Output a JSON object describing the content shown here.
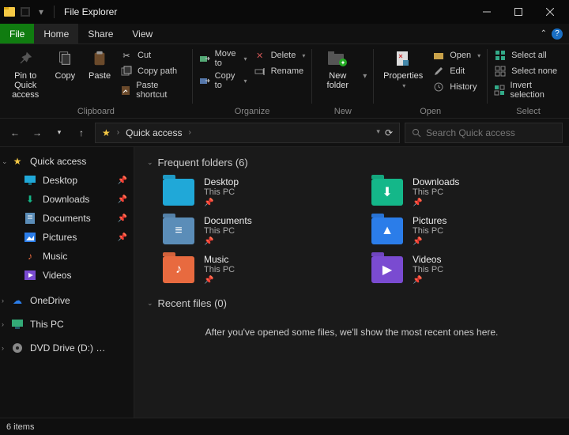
{
  "window": {
    "title": "File Explorer"
  },
  "tabs": {
    "file": "File",
    "home": "Home",
    "share": "Share",
    "view": "View"
  },
  "ribbon": {
    "clipboard": {
      "label": "Clipboard",
      "pin": "Pin to Quick access",
      "copy": "Copy",
      "paste": "Paste",
      "cut": "Cut",
      "copy_path": "Copy path",
      "paste_shortcut": "Paste shortcut"
    },
    "organize": {
      "label": "Organize",
      "move_to": "Move to",
      "copy_to": "Copy to",
      "delete": "Delete",
      "rename": "Rename"
    },
    "new": {
      "label": "New",
      "new_folder": "New folder"
    },
    "open": {
      "label": "Open",
      "properties": "Properties",
      "open": "Open",
      "edit": "Edit",
      "history": "History"
    },
    "select": {
      "label": "Select",
      "select_all": "Select all",
      "select_none": "Select none",
      "invert": "Invert selection"
    }
  },
  "address": {
    "crumb": "Quick access"
  },
  "search": {
    "placeholder": "Search Quick access"
  },
  "sidebar": {
    "quick_access": "Quick access",
    "desktop": "Desktop",
    "downloads": "Downloads",
    "documents": "Documents",
    "pictures": "Pictures",
    "music": "Music",
    "videos": "Videos",
    "onedrive": "OneDrive",
    "this_pc": "This PC",
    "dvd": "DVD Drive (D:) CC"
  },
  "main": {
    "frequent_header": "Frequent folders (6)",
    "recent_header": "Recent files (0)",
    "recent_empty": "After you've opened some files, we'll show the most recent ones here.",
    "this_pc": "This PC",
    "folders": {
      "desktop": "Desktop",
      "downloads": "Downloads",
      "documents": "Documents",
      "pictures": "Pictures",
      "music": "Music",
      "videos": "Videos"
    }
  },
  "status": {
    "items": "6 items"
  },
  "colors": {
    "desktop": "#20a8d8",
    "downloads": "#14b789",
    "documents": "#5b8db8",
    "pictures": "#2b7de9",
    "music": "#e86a3f",
    "videos": "#7a4bd1"
  }
}
